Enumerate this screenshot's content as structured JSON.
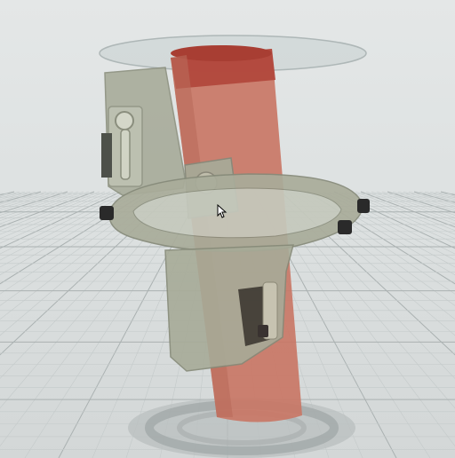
{
  "viewport": {
    "background": "#dde1e1",
    "grid_color": "#c4caca",
    "grid_major_color": "#aab1b1"
  },
  "model": {
    "tube_color": "#c97766",
    "tube_top_color": "#b0453a",
    "part_color": "#a9ac9a",
    "part_dark_color": "#8c8f7f",
    "servo_color": "#9aa08a",
    "screw_color": "#2a2a2a",
    "disc_color": "#c6cfcf",
    "shadow_color": "#a6acac"
  },
  "icons": {
    "cursor": "mouse-pointer-icon"
  }
}
